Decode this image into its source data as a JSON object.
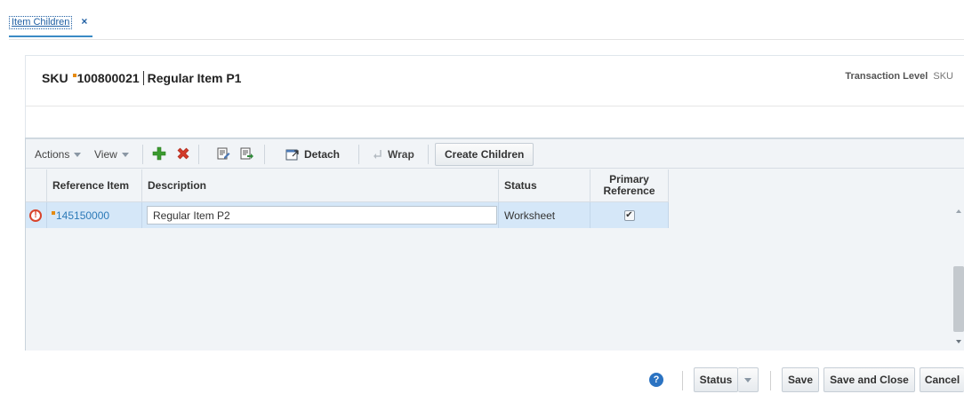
{
  "tab": {
    "label": "Item Children",
    "close": "×"
  },
  "header": {
    "item_type": "SKU",
    "item_number": "100800021",
    "item_desc": "Regular Item P1",
    "transaction_level_label": "Transaction Level",
    "transaction_level_value": "SKU"
  },
  "toolbar": {
    "actions_label": "Actions",
    "view_label": "View",
    "detach_label": "Detach",
    "wrap_label": "Wrap",
    "create_children_label": "Create Children"
  },
  "table": {
    "columns": [
      "Reference Item",
      "Description",
      "Status",
      "Primary Reference"
    ],
    "rows": [
      {
        "reference_item": "145150000",
        "description": "Regular Item P2",
        "status": "Worksheet",
        "primary_reference": true
      }
    ]
  },
  "footer": {
    "help": "?",
    "status_label": "Status",
    "save_label": "Save",
    "save_close_label": "Save and Close",
    "cancel_label": "Cancel"
  },
  "colors": {
    "accent": "#2b73c2",
    "selected_row": "#d5e7f8",
    "required_mark": "#e58a10",
    "error": "#d8432b"
  }
}
